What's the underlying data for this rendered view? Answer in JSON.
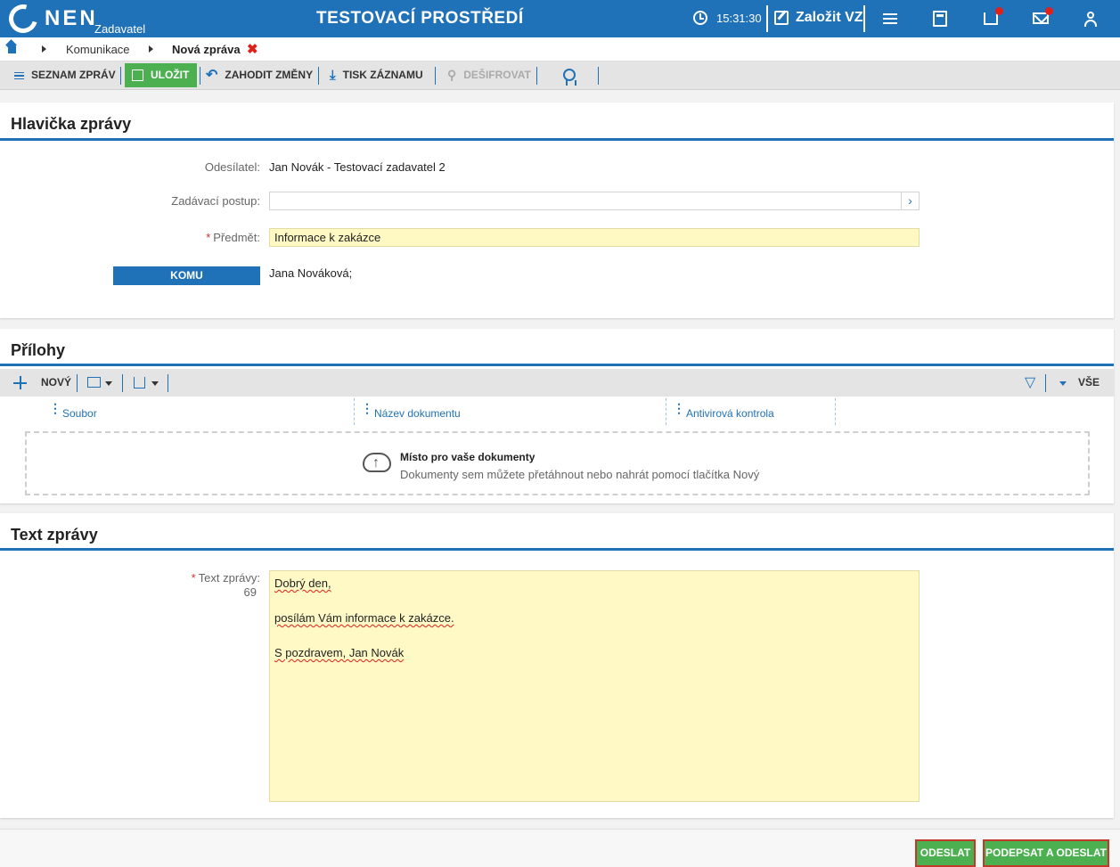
{
  "header": {
    "logo_text": "NEN",
    "logo_sub": "Zadavatel",
    "env_title": "TESTOVACÍ PROSTŘEDÍ",
    "time": "15:31:30",
    "create_label": "Založit VZ"
  },
  "breadcrumb": {
    "items": [
      "Komunikace",
      "Nová zpráva"
    ]
  },
  "toolbar": {
    "list_label": "SEZNAM ZPRÁV",
    "save_label": "ULOŽIT",
    "discard_label": "ZAHODIT ZMĚNY",
    "print_label": "TISK ZÁZNAMU",
    "decrypt_label": "DEŠIFROVAT"
  },
  "message_header": {
    "title": "Hlavička zprávy",
    "sender_label": "Odesílatel:",
    "sender_value": "Jan Novák - Testovací zadavatel 2",
    "procedure_label": "Zadávací postup:",
    "procedure_value": "",
    "subject_label": "Předmět:",
    "subject_value": "Informace k zakázce",
    "to_button": "KOMU",
    "to_value": "Jana Nováková;"
  },
  "attachments": {
    "title": "Přílohy",
    "new_label": "NOVÝ",
    "all_label": "VŠE",
    "columns": [
      "Soubor",
      "Název dokumentu",
      "Antivirová kontrola"
    ],
    "drop_title": "Místo pro vaše dokumenty",
    "drop_subtitle": "Dokumenty sem můžete přetáhnout nebo nahrát pomocí tlačítka Nový"
  },
  "message_text": {
    "title": "Text zprávy",
    "label": "Text zprávy:",
    "char_count": "69",
    "lines": [
      "Dobrý den,",
      "posílám Vám informace k zakázce.",
      "S pozdravem, Jan Novák"
    ]
  },
  "footer": {
    "send_label": "ODESLAT",
    "sign_send_label": "PODEPSAT A ODESLAT"
  },
  "colors": {
    "brand": "#1f71b8",
    "success": "#4caf50",
    "required": "#d32f2f",
    "field_highlight": "#fef8c2"
  }
}
